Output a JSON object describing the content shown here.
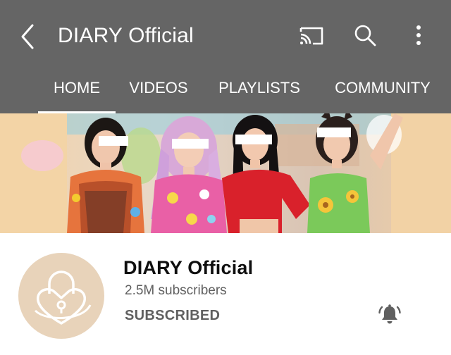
{
  "header": {
    "title": "DIARY Official",
    "icons": {
      "back": "back-arrow-icon",
      "cast": "cast-icon",
      "search": "search-icon",
      "more": "more-vert-icon"
    },
    "background_color": "#656565"
  },
  "tabs": [
    {
      "label": "HOME",
      "active": true
    },
    {
      "label": "VIDEOS",
      "active": false
    },
    {
      "label": "PLAYLISTS",
      "active": false
    },
    {
      "label": "COMMUNITY",
      "active": false
    }
  ],
  "banner": {
    "people_count": 4,
    "faces_obscured": true
  },
  "channel": {
    "name": "DIARY Official",
    "subscribers": "2.5M subscribers",
    "subscribe_state": "SUBSCRIBED",
    "avatar_icon": "heart-lock-icon",
    "avatar_color": "#e8d3ba",
    "bell_icon": "notification-bell-ringing-icon"
  }
}
